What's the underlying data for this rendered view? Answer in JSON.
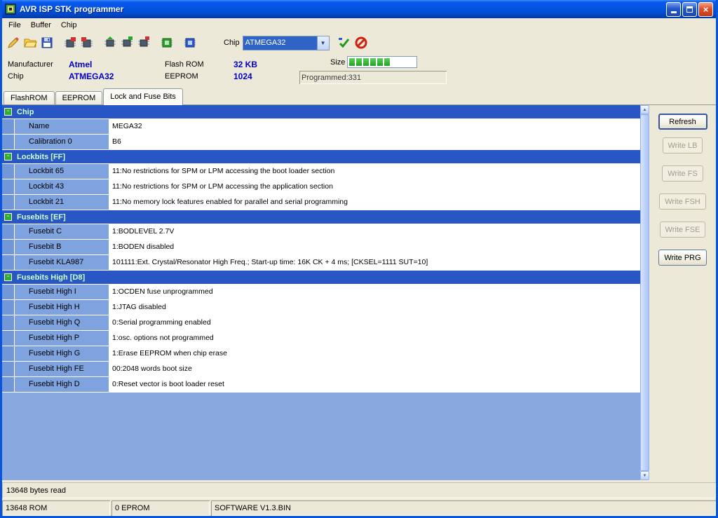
{
  "window": {
    "title": "AVR ISP STK programmer",
    "menu": [
      "File",
      "Buffer",
      "Chip"
    ]
  },
  "toolbar": {
    "chip_label": "Chip",
    "chip_selected": "ATMEGA32",
    "icons": [
      "erase-icon",
      "open-icon",
      "save-icon",
      "read-flash-icon",
      "read-eeprom-icon",
      "write-flash-icon",
      "write-eeprom-icon",
      "erase-chip-icon",
      "program-icon",
      "device-icon",
      "verify-icon",
      "cancel-icon"
    ]
  },
  "info": {
    "manufacturer_label": "Manufacturer",
    "manufacturer": "Atmel",
    "chip_label": "Chip",
    "chip": "ATMEGA32",
    "flashrom_label": "Flash ROM",
    "flashrom": "32 KB",
    "eeprom_label": "EEPROM",
    "eeprom": "1024",
    "size_label": "Size",
    "size_filled_segments": 6,
    "programmed": "Programmed:331"
  },
  "tabs": [
    {
      "label": "FlashROM",
      "active": false
    },
    {
      "label": "EEPROM",
      "active": false
    },
    {
      "label": "Lock and Fuse Bits",
      "active": true
    }
  ],
  "grid": {
    "groups": [
      {
        "header": "Chip",
        "rows": [
          {
            "name": "Name",
            "value": "MEGA32"
          },
          {
            "name": "Calibration 0",
            "value": "B6"
          }
        ]
      },
      {
        "header": "Lockbits [FF]",
        "rows": [
          {
            "name": "Lockbit 65",
            "value": "11:No restrictions for SPM or LPM accessing the boot loader section"
          },
          {
            "name": "Lockbit 43",
            "value": "11:No restrictions for SPM or LPM accessing the application section"
          },
          {
            "name": "Lockbit 21",
            "value": "11:No memory lock features enabled for parallel and serial programming"
          }
        ]
      },
      {
        "header": "Fusebits [EF]",
        "rows": [
          {
            "name": "Fusebit C",
            "value": "1:BODLEVEL 2.7V"
          },
          {
            "name": "Fusebit B",
            "value": "1:BODEN disabled"
          },
          {
            "name": "Fusebit KLA987",
            "value": "101111:Ext. Crystal/Resonator High Freq.; Start-up time: 16K CK + 4 ms; [CKSEL=1111 SUT=10]"
          }
        ]
      },
      {
        "header": "Fusebits High [D8]",
        "rows": [
          {
            "name": "Fusebit High I",
            "value": "1:OCDEN fuse unprogrammed"
          },
          {
            "name": "Fusebit High H",
            "value": "1:JTAG disabled"
          },
          {
            "name": "Fusebit High Q",
            "value": "0:Serial programming enabled"
          },
          {
            "name": "Fusebit High P",
            "value": "1:osc. options not programmed"
          },
          {
            "name": "Fusebit High G",
            "value": "1:Erase EEPROM when chip erase"
          },
          {
            "name": "Fusebit High FE",
            "value": "00:2048 words boot size"
          },
          {
            "name": "Fusebit High D",
            "value": "0:Reset vector is boot loader reset"
          }
        ]
      }
    ]
  },
  "side_buttons": [
    {
      "label": "Refresh",
      "enabled": true
    },
    {
      "label": "Write LB",
      "enabled": false
    },
    {
      "label": "Write FS",
      "enabled": false
    },
    {
      "label": "Write FSH",
      "enabled": false
    },
    {
      "label": "Write FSE",
      "enabled": false
    },
    {
      "label": "Write PRG",
      "enabled": true
    }
  ],
  "status": {
    "message": "13648 bytes read",
    "panels": [
      "13648 ROM",
      "0 EPROM",
      "SOFTWARE V1.3.BIN"
    ]
  },
  "colors": {
    "titlebar_blue": "#0353e0",
    "group_header_blue": "#2956c5",
    "row_label_blue": "#7fa3df",
    "filler_blue": "#8aa8e0",
    "value_blue_text": "#0000c8",
    "progress_green": "#23a123"
  }
}
